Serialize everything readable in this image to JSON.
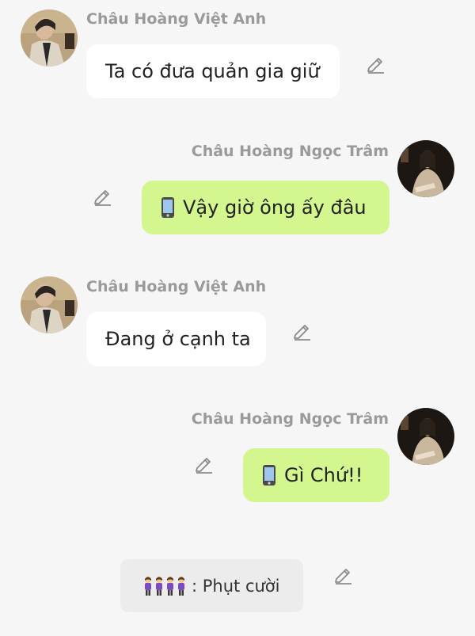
{
  "messages": [
    {
      "side": "left",
      "sender": "Châu Hoàng Việt Anh",
      "text": "Ta có đưa quản gia giữ",
      "bubble": "white",
      "icon": "none"
    },
    {
      "side": "right",
      "sender": "Châu Hoàng Ngọc Trâm",
      "text": "Vậy giờ ông ấy đâu",
      "bubble": "green",
      "icon": "mobile-phone-icon"
    },
    {
      "side": "left",
      "sender": "Châu Hoàng Việt Anh",
      "text": "Đang ở cạnh ta",
      "bubble": "white",
      "icon": "none"
    },
    {
      "side": "right",
      "sender": "Châu Hoàng Ngọc Trâm",
      "text": "Gì Chứ!!",
      "bubble": "green",
      "icon": "mobile-phone-icon"
    }
  ],
  "system_message": {
    "emoji": "people-holding-hands-icon",
    "text": ": Phụt cười"
  },
  "colors": {
    "background": "#f6f6f6",
    "bubble_white": "#ffffff",
    "bubble_green": "#d4f68f",
    "sender_text": "#9a9a9a",
    "system_bubble": "#ececec"
  },
  "icons": [
    "edit-pencil-icon",
    "mobile-phone-icon",
    "people-holding-hands-icon",
    "avatar-man",
    "avatar-woman"
  ]
}
